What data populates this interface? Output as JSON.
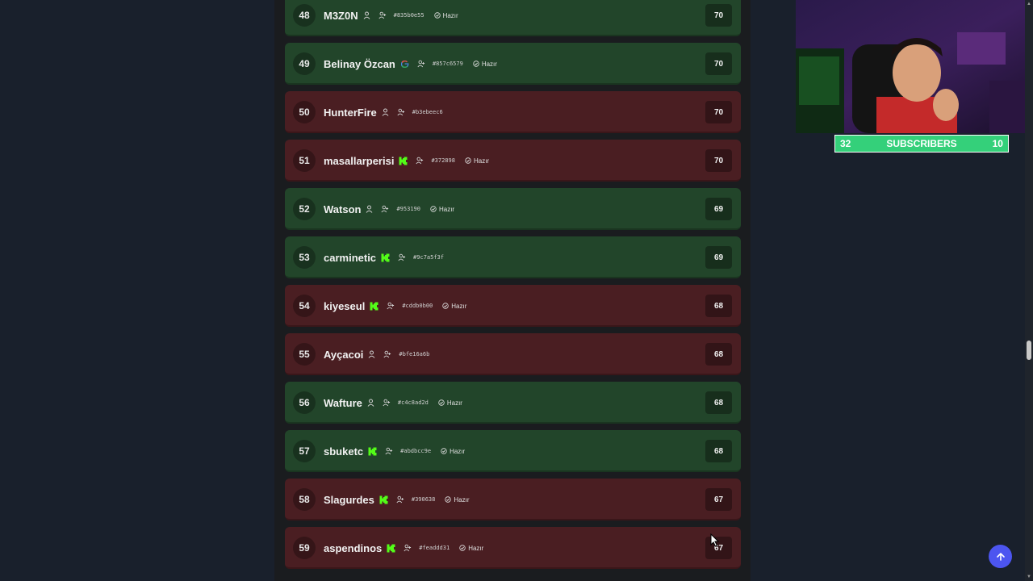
{
  "rows": [
    {
      "rank": "48",
      "name": "M3Z0N",
      "hash": "#835b0e55",
      "status": "Hazır",
      "score": "70",
      "color": "green",
      "platform": "person-icon"
    },
    {
      "rank": "49",
      "name": "Belinay Özcan",
      "hash": "#857c6579",
      "status": "Hazır",
      "score": "70",
      "color": "green",
      "platform": "google-icon"
    },
    {
      "rank": "50",
      "name": "HunterFire",
      "hash": "#b3ebeec6",
      "status": "",
      "score": "70",
      "color": "red",
      "platform": "person-icon"
    },
    {
      "rank": "51",
      "name": "masallarperisi",
      "hash": "#372898",
      "status": "Hazır",
      "score": "70",
      "color": "red",
      "platform": "kick-icon"
    },
    {
      "rank": "52",
      "name": "Watson",
      "hash": "#953190",
      "status": "Hazır",
      "score": "69",
      "color": "green",
      "platform": "person-icon"
    },
    {
      "rank": "53",
      "name": "carminetic",
      "hash": "#9c7a5f3f",
      "status": "",
      "score": "69",
      "color": "green",
      "platform": "kick-icon"
    },
    {
      "rank": "54",
      "name": "kiyeseul",
      "hash": "#cddb0b00",
      "status": "Hazır",
      "score": "68",
      "color": "red",
      "platform": "kick-icon"
    },
    {
      "rank": "55",
      "name": "Ayçacoi",
      "hash": "#bfe16a6b",
      "status": "",
      "score": "68",
      "color": "red",
      "platform": "person-icon"
    },
    {
      "rank": "56",
      "name": "Wafture",
      "hash": "#c4c8ad2d",
      "status": "Hazır",
      "score": "68",
      "color": "green",
      "platform": "person-icon"
    },
    {
      "rank": "57",
      "name": "sbuketc",
      "hash": "#abdbcc9e",
      "status": "Hazır",
      "score": "68",
      "color": "green",
      "platform": "kick-icon"
    },
    {
      "rank": "58",
      "name": "Slagurdes",
      "hash": "#390638",
      "status": "Hazır",
      "score": "67",
      "color": "red",
      "platform": "kick-icon"
    },
    {
      "rank": "59",
      "name": "aspendinos",
      "hash": "#feaddd31",
      "status": "Hazır",
      "score": "67",
      "color": "red",
      "platform": "kick-icon"
    }
  ],
  "overlay": {
    "sub_left": "32",
    "sub_label": "SUBSCRIBERS",
    "sub_right": "10"
  },
  "colors": {
    "green_row": "#22452a",
    "red_row": "#4a1e22",
    "kick_green": "#53fc18",
    "sub_bar": "#34d07a",
    "scroll_button": "#4c55f0"
  }
}
